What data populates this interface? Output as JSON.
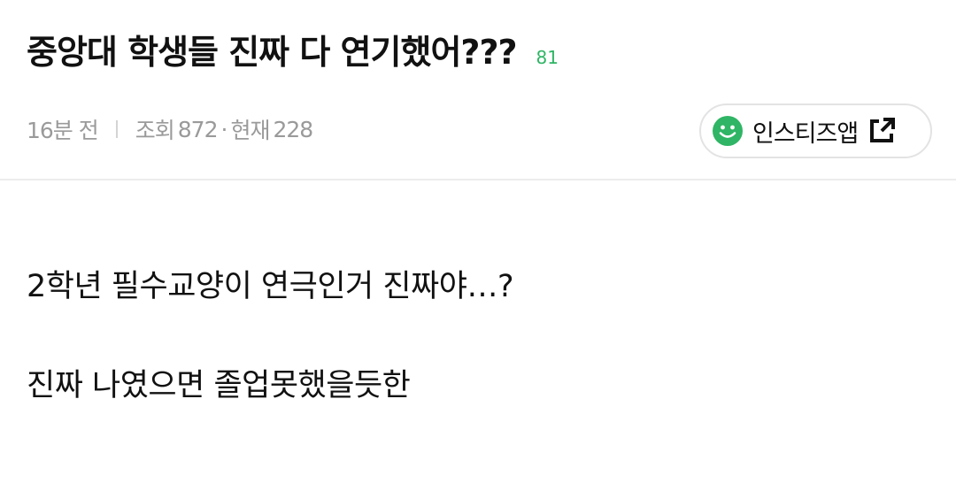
{
  "post": {
    "title": "중앙대 학생들 진짜 다 연기했어???",
    "comment_count": "81",
    "time_ago": "16분 전",
    "views_label": "조회",
    "views": "872",
    "dot": "·",
    "current_label": "현재",
    "current": "228"
  },
  "app_button": {
    "label": "인스티즈앱",
    "icon": "smile-icon",
    "external_icon": "external-link-icon",
    "accent": "#2fb565"
  },
  "body": {
    "paragraphs": [
      "2학년 필수교양이 연극인거 진짜야…?",
      "진짜 나였으면 졸업못했을듯한"
    ]
  }
}
